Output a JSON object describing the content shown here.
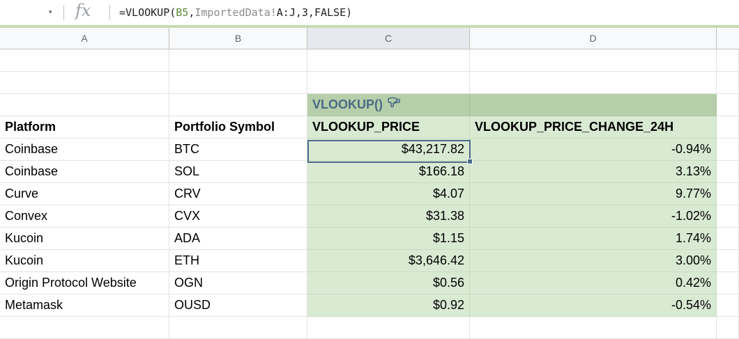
{
  "formula_bar": {
    "dropdown": "▾",
    "fx_label": "fx",
    "formula_prefix": "=VLOOKUP(",
    "formula_ref": "B5",
    "formula_comma1": ",",
    "formula_sheet": "ImportedData!",
    "formula_rest": "A:J,3,FALSE)"
  },
  "columns": [
    "A",
    "B",
    "C",
    "D"
  ],
  "selected_column": "C",
  "banner": {
    "label": "VLOOKUP()",
    "icon": "pointing-down-hand-icon"
  },
  "headers": {
    "a": "Platform",
    "b": "Portfolio Symbol",
    "c": "VLOOKUP_PRICE",
    "d": "VLOOKUP_PRICE_CHANGE_24H"
  },
  "rows": [
    {
      "platform": "Coinbase",
      "symbol": "BTC",
      "price": "$43,217.82",
      "change": "-0.94%"
    },
    {
      "platform": "Coinbase",
      "symbol": "SOL",
      "price": "$166.18",
      "change": "3.13%"
    },
    {
      "platform": "Curve",
      "symbol": "CRV",
      "price": "$4.07",
      "change": "9.77%"
    },
    {
      "platform": "Convex",
      "symbol": "CVX",
      "price": "$31.38",
      "change": "-1.02%"
    },
    {
      "platform": "Kucoin",
      "symbol": "ADA",
      "price": "$1.15",
      "change": "1.74%"
    },
    {
      "platform": "Kucoin",
      "symbol": "ETH",
      "price": "$3,646.42",
      "change": "3.00%"
    },
    {
      "platform": "Origin Protocol Website",
      "symbol": "OGN",
      "price": "$0.56",
      "change": "0.42%"
    },
    {
      "platform": "Metamask",
      "symbol": "OUSD",
      "price": "$0.92",
      "change": "-0.54%"
    }
  ],
  "colors": {
    "light_green": "#d9ead3",
    "dark_green": "#b6cfaa",
    "selection": "#4b6a8a",
    "banner_text": "#4a6a84"
  }
}
